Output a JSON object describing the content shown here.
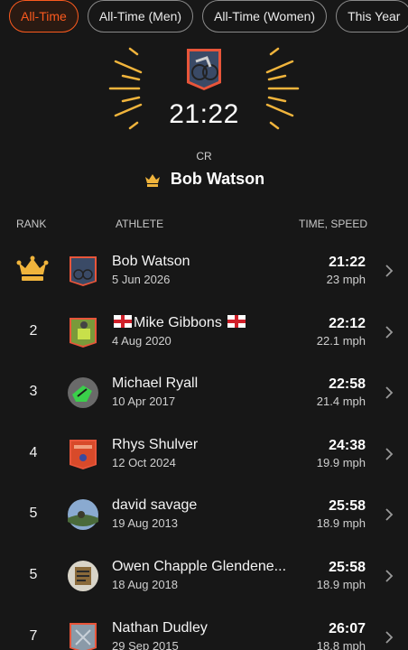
{
  "filters": [
    {
      "label": "All-Time",
      "active": true
    },
    {
      "label": "All-Time (Men)",
      "active": false
    },
    {
      "label": "All-Time (Women)",
      "active": false
    },
    {
      "label": "This Year",
      "active": false
    }
  ],
  "hero": {
    "time": "21:22",
    "badge": "CR",
    "name": "Bob Watson",
    "icon": "crown-icon"
  },
  "headers": {
    "rank": "RANK",
    "athlete": "ATHLETE",
    "time_speed": "TIME, SPEED"
  },
  "entries": [
    {
      "rank": "",
      "name": "Bob Watson",
      "date": "5 Jun 2026",
      "time": "21:22",
      "speed": "23 mph"
    },
    {
      "rank": "2",
      "name": "Mike Gibbons",
      "date": "4 Aug 2020",
      "time": "22:12",
      "speed": "22.1 mph"
    },
    {
      "rank": "3",
      "name": "Michael Ryall",
      "date": "10 Apr 2017",
      "time": "22:58",
      "speed": "21.4 mph"
    },
    {
      "rank": "4",
      "name": "Rhys Shulver",
      "date": "12 Oct 2024",
      "time": "24:38",
      "speed": "19.9 mph"
    },
    {
      "rank": "5",
      "name": "david savage",
      "date": "19 Aug 2013",
      "time": "25:58",
      "speed": "18.9 mph"
    },
    {
      "rank": "5",
      "name": "Owen Chapple Glendene...",
      "date": "18 Aug 2018",
      "time": "25:58",
      "speed": "18.9 mph"
    },
    {
      "rank": "7",
      "name": "Nathan Dudley",
      "date": "29 Sep 2015",
      "time": "26:07",
      "speed": "18.8 mph"
    }
  ],
  "colors": {
    "accent": "#fc5a1e",
    "gold": "#f0b43c",
    "background": "#171717"
  }
}
